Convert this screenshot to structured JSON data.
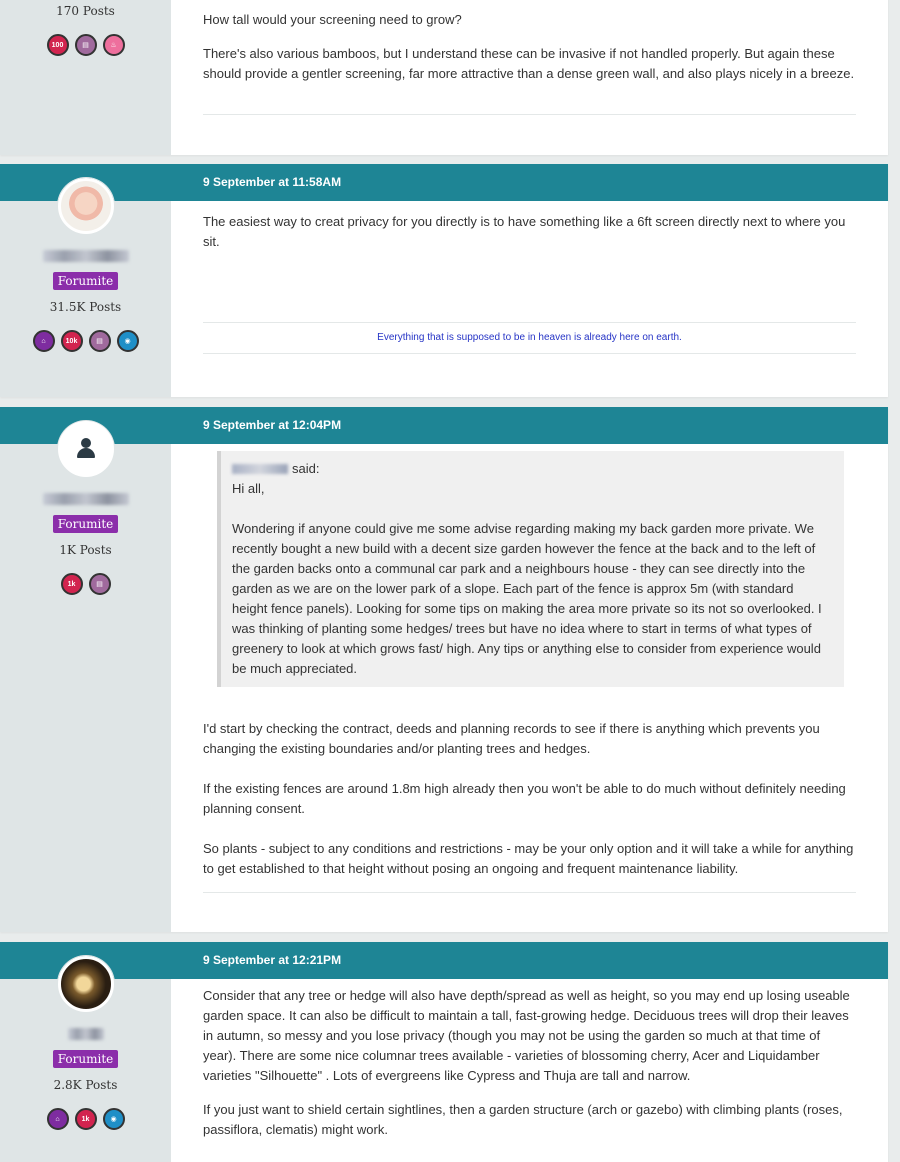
{
  "posts": [
    {
      "posts_count": "170 Posts",
      "badges": [
        {
          "label": "100",
          "color": "red"
        },
        {
          "label": "",
          "color": "mauve",
          "icon": "book-icon"
        },
        {
          "label": "",
          "color": "pink",
          "icon": "cake-icon"
        }
      ],
      "paragraphs": [
        "How tall would your screening need to grow?",
        "There's also various bamboos, but I understand these can be invasive if not handled properly. But again these should provide a gentler screening, far more attractive than a dense green wall, and also plays nicely in a breeze."
      ]
    },
    {
      "date": "9 September at 11:58AM",
      "rank": "Forumite",
      "posts_count": "31.5K Posts",
      "badges": [
        {
          "label": "",
          "color": "purple",
          "icon": "house-icon"
        },
        {
          "label": "10k",
          "color": "red"
        },
        {
          "label": "",
          "color": "mauve",
          "icon": "book-icon"
        },
        {
          "label": "",
          "color": "blue",
          "icon": "camera-icon"
        }
      ],
      "paragraphs": [
        "The easiest way to creat privacy for you directly is to have something like a 6ft screen directly next to where you sit."
      ],
      "signature": "Everything that is supposed to be in heaven is already here on earth."
    },
    {
      "date": "9 September at 12:04PM",
      "rank": "Forumite",
      "posts_count": "1K Posts",
      "badges": [
        {
          "label": "1k",
          "color": "red"
        },
        {
          "label": "",
          "color": "mauve",
          "icon": "book-icon"
        }
      ],
      "quote": {
        "said": "said:",
        "lines": [
          "Hi all,",
          "Wondering if anyone could give me some advise regarding making my back garden more private. We recently bought a new build with a decent size garden however the fence at the back and to the left of the garden backs onto a communal car park and a neighbours house - they can see directly into the garden as we are on the lower park of a slope. Each part of the fence is approx 5m (with standard height fence panels). Looking for some tips on making the area more private so its not so overlooked. I was thinking of planting some hedges/ trees but have no idea where to start in terms of what types of greenery to look at which grows fast/ high. Any tips or anything else to consider from experience would be much appreciated."
        ]
      },
      "paragraphs": [
        "I'd start by checking the contract, deeds and planning records to see if there is anything which prevents you changing the existing boundaries and/or planting trees and hedges.",
        "If the existing fences are around 1.8m high already then you won't be able to do much without definitely needing planning consent.",
        "So plants - subject to any conditions and restrictions - may be your only option and it will take a while for anything to get established to that height without posing an ongoing and frequent maintenance liability."
      ]
    },
    {
      "date": "9 September at 12:21PM",
      "rank": "Forumite",
      "posts_count": "2.8K Posts",
      "badges": [
        {
          "label": "",
          "color": "purple",
          "icon": "house-icon"
        },
        {
          "label": "1k",
          "color": "red"
        },
        {
          "label": "",
          "color": "blue",
          "icon": "camera-icon"
        }
      ],
      "paragraphs": [
        "Consider that any tree or hedge will also have depth/spread as well as height, so you may end up losing useable garden space. It can also be difficult to maintain a tall, fast-growing hedge. Deciduous trees will drop their leaves in autumn, so messy and you lose privacy (though you may not be using the garden so much at that time of year). There are some nice columnar trees available - varieties of blossoming cherry, Acer and Liquidamber varieties \"Silhouette\" . Lots of evergreens like Cypress and Thuja are tall and narrow.",
        "If you just want to shield certain sightlines, then a garden structure (arch or gazebo) with climbing plants (roses, passiflora, clematis) might work."
      ]
    }
  ],
  "colors": {
    "header": "#1e8595",
    "sidebar": "#dfe5e6",
    "rank_badge": "#8b2eaa",
    "signature": "#2634c6"
  }
}
